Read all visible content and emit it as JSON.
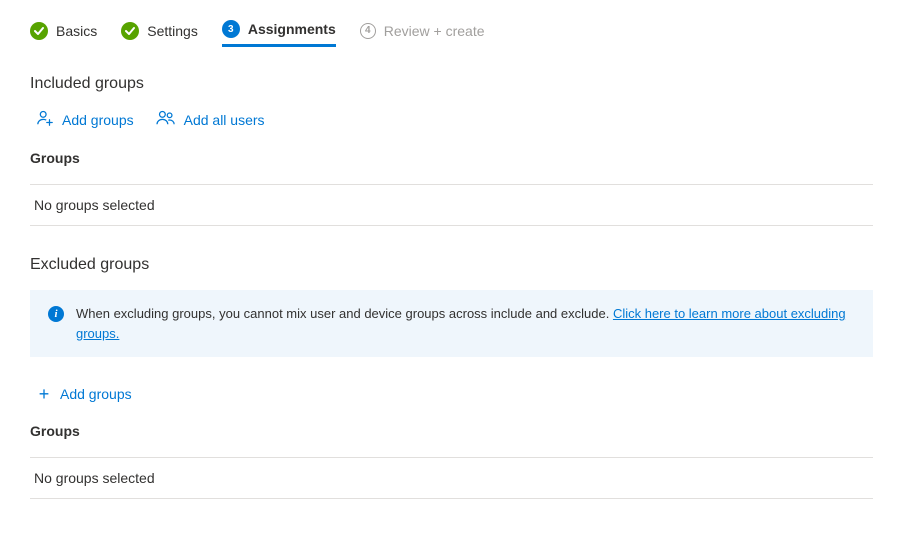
{
  "wizard": {
    "steps": [
      {
        "label": "Basics",
        "state": "done"
      },
      {
        "label": "Settings",
        "state": "done"
      },
      {
        "label": "Assignments",
        "state": "current",
        "number": "3"
      },
      {
        "label": "Review + create",
        "state": "future",
        "number": "4"
      }
    ]
  },
  "included": {
    "title": "Included groups",
    "add_groups_label": "Add groups",
    "add_all_users_label": "Add all users",
    "groups_heading": "Groups",
    "empty_text": "No groups selected"
  },
  "excluded": {
    "title": "Excluded groups",
    "info_text": "When excluding groups, you cannot mix user and device groups across include and exclude. ",
    "info_link": "Click here to learn more about excluding groups.",
    "add_groups_label": "Add groups",
    "groups_heading": "Groups",
    "empty_text": "No groups selected"
  }
}
